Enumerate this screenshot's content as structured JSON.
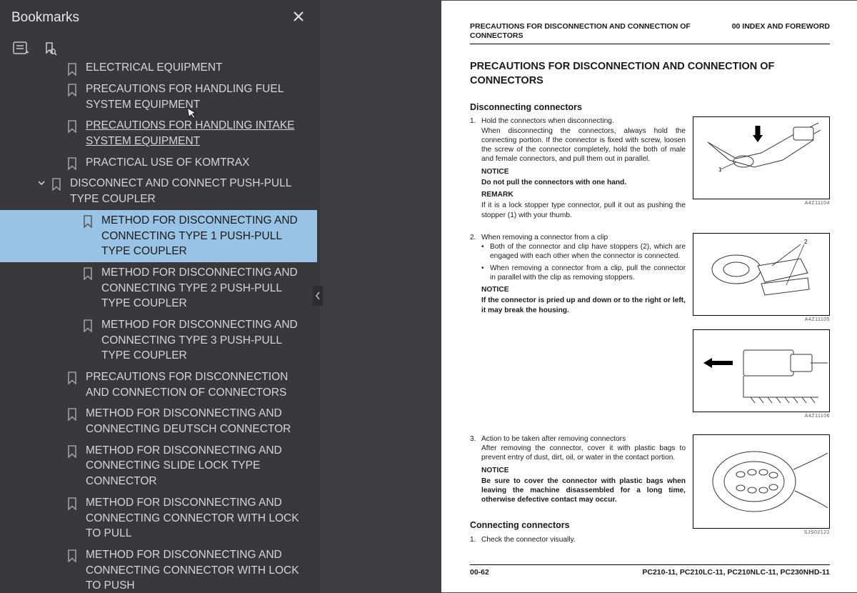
{
  "sidebar": {
    "title": "Bookmarks",
    "items": [
      {
        "level": 1,
        "label": "ELECTRICAL EQUIPMENT",
        "truncated": true
      },
      {
        "level": 1,
        "label": "PRECAUTIONS FOR HANDLING FUEL SYSTEM EQUIPMENT"
      },
      {
        "level": 1,
        "label": "PRECAUTIONS FOR HANDLING INTAKE SYSTEM EQUIPMENT",
        "hover": true
      },
      {
        "level": 1,
        "label": "PRACTICAL USE OF KOMTRAX"
      },
      {
        "level": 1,
        "label": "DISCONNECT AND CONNECT PUSH-PULL TYPE COUPLER",
        "expandable": true,
        "expanded": true
      },
      {
        "level": 2,
        "label": "METHOD FOR DISCONNECTING AND CONNECTING TYPE 1 PUSH-PULL TYPE COUPLER",
        "selected": true
      },
      {
        "level": 2,
        "label": "METHOD FOR DISCONNECTING AND CONNECTING TYPE 2 PUSH-PULL TYPE COUPLER"
      },
      {
        "level": 2,
        "label": "METHOD FOR DISCONNECTING AND CONNECTING TYPE 3 PUSH-PULL TYPE COUPLER"
      },
      {
        "level": 1,
        "label": "PRECAUTIONS FOR DISCONNECTION AND CONNECTION OF CONNECTORS"
      },
      {
        "level": 1,
        "label": "METHOD FOR DISCONNECTING AND CONNECTING DEUTSCH CONNECTOR"
      },
      {
        "level": 1,
        "label": "METHOD FOR DISCONNECTING AND CONNECTING SLIDE LOCK TYPE CONNECTOR"
      },
      {
        "level": 1,
        "label": "METHOD FOR DISCONNECTING AND CONNECTING CONNECTOR WITH LOCK TO PULL"
      },
      {
        "level": 1,
        "label": "METHOD FOR DISCONNECTING AND CONNECTING CONNECTOR WITH LOCK TO PUSH",
        "clipped": true
      }
    ]
  },
  "doc": {
    "head_left": "PRECAUTIONS FOR DISCONNECTION AND CONNECTION OF CONNECTORS",
    "head_right": "00 INDEX AND FOREWORD",
    "title": "PRECAUTIONS FOR DISCONNECTION AND CONNECTION OF CONNECTORS",
    "sec1_title": "Disconnecting connectors",
    "item1_lead": "Hold the connectors when disconnecting.",
    "item1_p1": "When disconnecting the connectors, always hold the connecting portion. If the connector is fixed with screw, loosen the screw of the connector completely, hold the both of male and female connectors, and pull them out in parallel.",
    "notice": "NOTICE",
    "item1_notice": "Do not pull the connectors with one hand.",
    "remark": "REMARK",
    "item1_remark": "If it is a lock stopper type connector, pull it out as pushing the stopper (1) with your thumb.",
    "item2_lead": "When removing a connector from a clip",
    "item2_b1": "Both of the connector and clip have stoppers (2), which are engaged with each other when the connector is connected.",
    "item2_b2": "When removing a connector from a clip, pull the connector in parallel with the clip as removing stoppers.",
    "item2_notice": "If the connector is pried up and down or to the right or left, it may break the housing.",
    "item3_lead": "Action to be taken after removing connectors",
    "item3_p1": "After removing the connector, cover it with plastic bags to prevent entry of dust, dirt, oil, or water in the contact portion.",
    "item3_notice": "Be sure to cover the connector with plastic bags when leaving the machine disassembled for a long time, otherwise defective contact may occur.",
    "sec2_title": "Connecting connectors",
    "cc1": "Check the connector visually.",
    "fig_labels": [
      "A4Z11104",
      "A4Z11105",
      "A4Z11106",
      "SJS02122"
    ],
    "foot_left": "00-62",
    "foot_right": "PC210-11, PC210LC-11, PC210NLC-11, PC230NHD-11"
  }
}
